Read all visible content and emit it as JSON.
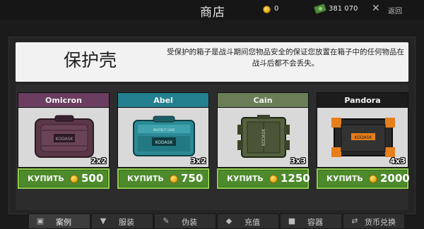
{
  "topbar": {
    "title": "商店",
    "coins": "0",
    "cash": "381 070",
    "close_glyph": "✕",
    "back_label": "返回"
  },
  "header": {
    "title": "保护壳",
    "description": "受保护的箱子是战斗期间您物品安全的保证您放置在箱子中的任何物品在战斗后都不会丢失。"
  },
  "cards": [
    {
      "name": "Omicron",
      "size": "2x2",
      "buy_label": "КУПИТЬ",
      "price": "500",
      "header_color": "#6b3d61"
    },
    {
      "name": "Abel",
      "size": "3x2",
      "buy_label": "КУПИТЬ",
      "price": "750",
      "header_color": "#23818f"
    },
    {
      "name": "Cain",
      "size": "3x3",
      "buy_label": "КУПИТЬ",
      "price": "1250",
      "header_color": "#6b7d56"
    },
    {
      "name": "Pandora",
      "size": "4x3",
      "buy_label": "КУПИТЬ",
      "price": "2000",
      "header_color": "#1c1c1c"
    }
  ],
  "tabs": [
    {
      "label": "案例",
      "icon": "case-icon",
      "active": true
    },
    {
      "label": "服装",
      "icon": "shirt-icon",
      "active": false
    },
    {
      "label": "伪装",
      "icon": "brush-icon",
      "active": false
    },
    {
      "label": "充值",
      "icon": "gem-icon",
      "active": false
    },
    {
      "label": "容器",
      "icon": "box-icon",
      "active": false
    },
    {
      "label": "货币兑换",
      "icon": "exchange-icon",
      "active": false
    }
  ]
}
